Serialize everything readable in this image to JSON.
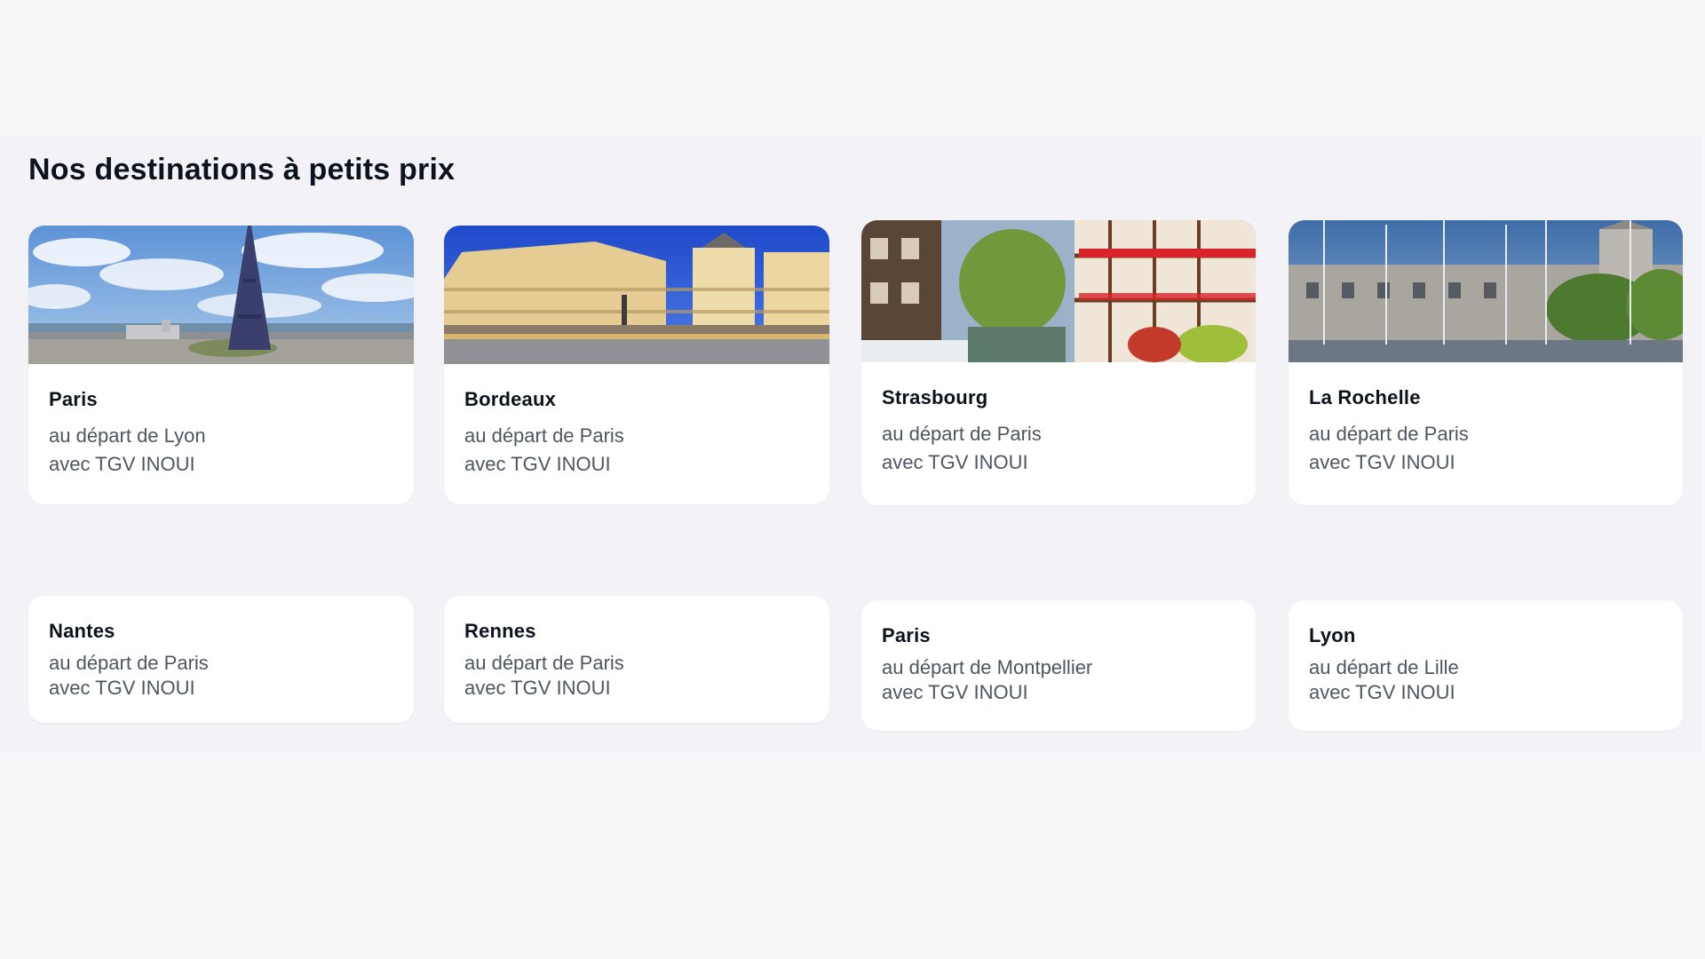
{
  "section": {
    "title": "Nos destinations à petits prix"
  },
  "cards": [
    {
      "city": "Paris",
      "departure": "au départ de Lyon",
      "service": "avec TGV INOUI",
      "image": "paris-eiffel-tower-photo"
    },
    {
      "city": "Bordeaux",
      "departure": "au départ de Paris",
      "service": "avec TGV INOUI",
      "image": "bordeaux-place-de-la-bourse-photo"
    },
    {
      "city": "Strasbourg",
      "departure": "au départ de Paris",
      "service": "avec TGV INOUI",
      "image": "strasbourg-petite-france-photo"
    },
    {
      "city": "La Rochelle",
      "departure": "au départ de Paris",
      "service": "avec TGV INOUI",
      "image": "la-rochelle-harbour-photo"
    },
    {
      "city": "Nantes",
      "departure": "au départ de Paris",
      "service": "avec TGV INOUI"
    },
    {
      "city": "Rennes",
      "departure": "au départ de Paris",
      "service": "avec TGV INOUI"
    },
    {
      "city": "Paris",
      "departure": "au départ de Montpellier",
      "service": "avec TGV INOUI"
    },
    {
      "city": "Lyon",
      "departure": "au départ de Lille",
      "service": "avec TGV INOUI"
    }
  ]
}
